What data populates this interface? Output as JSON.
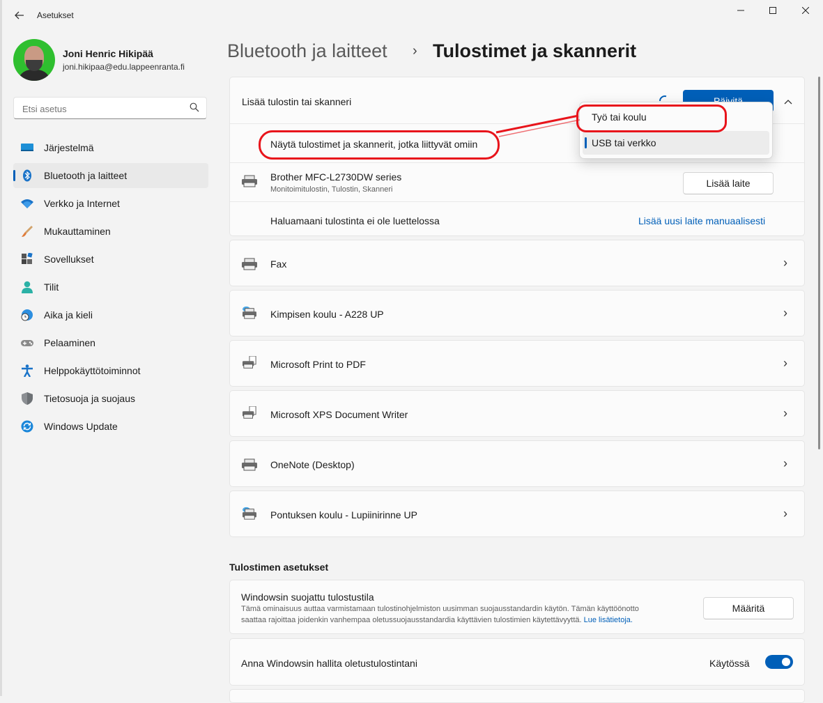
{
  "window": {
    "title": "Asetukset"
  },
  "profile": {
    "name": "Joni Henric Hikipää",
    "email": "joni.hikipaa@edu.lappeenranta.fi"
  },
  "search": {
    "placeholder": "Etsi asetus"
  },
  "sidebar": {
    "items": [
      {
        "label": "Järjestelmä",
        "icon": "system-icon"
      },
      {
        "label": "Bluetooth ja laitteet",
        "icon": "bluetooth-icon",
        "selected": true
      },
      {
        "label": "Verkko ja Internet",
        "icon": "wifi-icon"
      },
      {
        "label": "Mukauttaminen",
        "icon": "brush-icon"
      },
      {
        "label": "Sovellukset",
        "icon": "apps-icon"
      },
      {
        "label": "Tilit",
        "icon": "account-icon"
      },
      {
        "label": "Aika ja kieli",
        "icon": "globe-clock-icon"
      },
      {
        "label": "Pelaaminen",
        "icon": "gamepad-icon"
      },
      {
        "label": "Helppokäyttötoiminnot",
        "icon": "accessibility-icon"
      },
      {
        "label": "Tietosuoja ja suojaus",
        "icon": "shield-icon"
      },
      {
        "label": "Windows Update",
        "icon": "update-icon"
      }
    ]
  },
  "header": {
    "parent": "Bluetooth ja laitteet",
    "separator": "›",
    "current": "Tulostimet ja skannerit"
  },
  "add_device": {
    "label": "Lisää tulostin tai skanneri",
    "refresh_label": "Päivitä",
    "filter_text": "Näytä tulostimet ja skannerit, jotka liittyvät omiin",
    "found_device": {
      "name": "Brother MFC-L2730DW series",
      "desc": "Monitoimitulostin, Tulostin, Skanneri",
      "button": "Lisää laite"
    },
    "not_listed": {
      "text": "Haluamaani tulostinta ei ole luettelossa",
      "link": "Lisää uusi laite manuaalisesti"
    }
  },
  "dropdown": {
    "options": [
      {
        "label": "Työ tai koulu"
      },
      {
        "label": "USB tai verkko",
        "selected": true
      }
    ]
  },
  "printers": [
    {
      "name": "Fax",
      "icon": "printer-icon"
    },
    {
      "name": "Kimpisen koulu - A228 UP",
      "icon": "cloud-printer-icon"
    },
    {
      "name": "Microsoft Print to PDF",
      "icon": "document-printer-icon"
    },
    {
      "name": "Microsoft XPS Document Writer",
      "icon": "document-printer-icon"
    },
    {
      "name": "OneNote (Desktop)",
      "icon": "printer-icon"
    },
    {
      "name": "Pontuksen koulu - Lupiinirinne UP",
      "icon": "cloud-printer-icon"
    }
  ],
  "printer_settings": {
    "title": "Tulostimen asetukset",
    "protected_mode": {
      "title": "Windowsin suojattu tulostustila",
      "desc_line1": "Tämä ominaisuus auttaa varmistamaan tulostinohjelmiston uusimman suojausstandardin käytön. Tämän käyttöönotto",
      "desc_line2": "saattaa rajoittaa joidenkin vanhempaa oletussuojausstandardia käyttävien tulostimien käytettävyyttä.",
      "link": "Lue lisätietoja.",
      "button": "Määritä"
    },
    "default_printer": {
      "title": "Anna Windowsin hallita oletustulostintani",
      "state": "Käytössä",
      "enabled": true
    }
  },
  "colors": {
    "accent": "#005fb8",
    "annotation": "#e8141b"
  }
}
